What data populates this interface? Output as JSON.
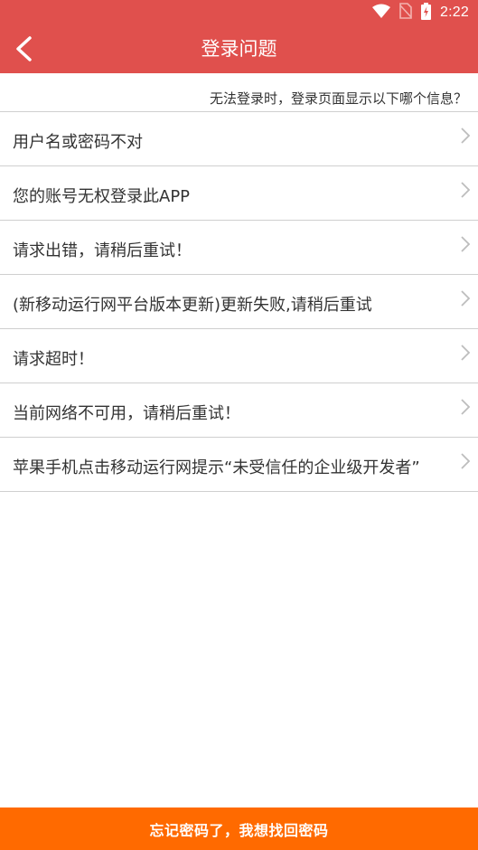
{
  "status_bar": {
    "time": "2:22",
    "icons": [
      "wifi-icon",
      "no-sim-icon",
      "battery-charging-icon"
    ]
  },
  "header": {
    "title": "登录问题",
    "back_icon": "chevron-left-icon"
  },
  "hint": "无法登录时，登录页面显示以下哪个信息？",
  "problems": [
    {
      "label": "用户名或密码不对"
    },
    {
      "label": "您的账号无权登录此APP"
    },
    {
      "label": "请求出错，请稍后重试！"
    },
    {
      "label": "(新移动运行网平台版本更新)更新失败,请稍后重试"
    },
    {
      "label": "请求超时！"
    },
    {
      "label": "当前网络不可用，请稍后重试！"
    },
    {
      "label": "苹果手机点击移动运行网提示“未受信任的企业级开发者”"
    }
  ],
  "footer": {
    "forgot_password_label": "忘记密码了，我想找回密码"
  },
  "colors": {
    "header_bg": "#e0504d",
    "footer_bg": "#ff6a00",
    "divider": "#cfcfcf",
    "chevron": "#bdbdbd"
  }
}
